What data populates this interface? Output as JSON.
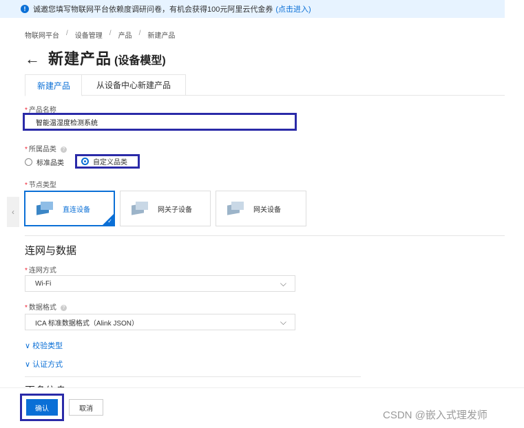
{
  "notice": {
    "icon": "info-icon",
    "text": "诚邀您填写物联网平台依赖度调研问卷，有机会获得100元阿里云代金券",
    "link": "(点击进入)"
  },
  "breadcrumb": [
    "物联网平台",
    "设备管理",
    "产品",
    "新建产品"
  ],
  "breadcrumb_sep": "/",
  "title": {
    "back": "←",
    "main": "新建产品",
    "sub": "(设备模型)"
  },
  "tabs": [
    {
      "label": "新建产品",
      "active": true
    },
    {
      "label": "从设备中心新建产品",
      "active": false
    }
  ],
  "form": {
    "product_name": {
      "label": "产品名称",
      "value": "智能温湿度检测系统"
    },
    "category": {
      "label": "所属品类",
      "options": [
        {
          "label": "标准品类",
          "checked": false
        },
        {
          "label": "自定义品类",
          "checked": true
        }
      ]
    },
    "node_type": {
      "label": "节点类型",
      "options": [
        {
          "label": "直连设备",
          "selected": true,
          "icon": "direct-device-icon"
        },
        {
          "label": "网关子设备",
          "selected": false,
          "icon": "gateway-subdevice-icon"
        },
        {
          "label": "网关设备",
          "selected": false,
          "icon": "gateway-device-icon"
        }
      ]
    }
  },
  "network_section": {
    "title": "连网与数据",
    "connection": {
      "label": "连网方式",
      "value": "Wi-Fi"
    },
    "data_format": {
      "label": "数据格式",
      "value": "ICA 标准数据格式（Alink JSON）"
    },
    "verify_type": "校验类型",
    "auth_type": "认证方式"
  },
  "more_info": "更多信息",
  "buttons": {
    "confirm": "确认",
    "cancel": "取消"
  },
  "watermark": "CSDN @嵌入式理发师",
  "colors": {
    "primary": "#0a6fd6",
    "highlight_box": "#2a2aa8",
    "required": "#ee2233"
  }
}
